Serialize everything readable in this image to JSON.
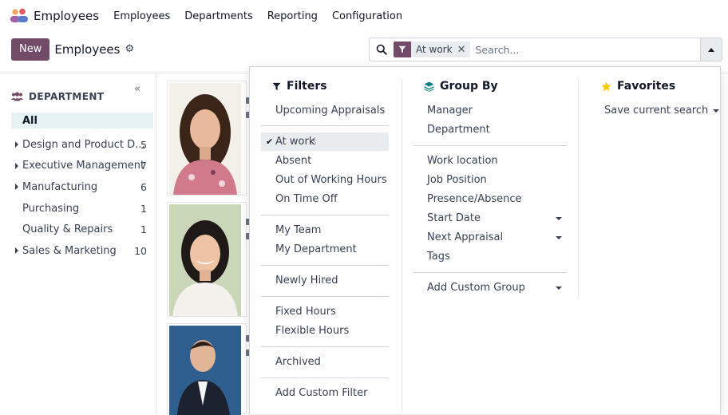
{
  "nav": {
    "app_name": "Employees",
    "menus": [
      "Employees",
      "Departments",
      "Reporting",
      "Configuration"
    ]
  },
  "control_panel": {
    "new_button": "New",
    "breadcrumb": "Employees"
  },
  "search": {
    "facet_value": "At work",
    "placeholder": "Search..."
  },
  "sidebar": {
    "header": "DEPARTMENT",
    "items": [
      {
        "label": "All",
        "count": "",
        "active": true,
        "expandable": false
      },
      {
        "label": "Design and Product D...",
        "count": "5",
        "expandable": true
      },
      {
        "label": "Executive Management",
        "count": "7",
        "expandable": true
      },
      {
        "label": "Manufacturing",
        "count": "6",
        "expandable": true
      },
      {
        "label": "Purchasing",
        "count": "1",
        "expandable": false
      },
      {
        "label": "Quality & Repairs",
        "count": "1",
        "expandable": false
      },
      {
        "label": "Sales & Marketing",
        "count": "10",
        "expandable": true
      }
    ]
  },
  "filters": {
    "title": "Filters",
    "items": [
      "Upcoming Appraisals",
      "At work",
      "Absent",
      "Out of Working Hours",
      "On Time Off",
      "My Team",
      "My Department",
      "Newly Hired",
      "Fixed Hours",
      "Flexible Hours",
      "Archived",
      "Add Custom Filter"
    ],
    "selected": "At work"
  },
  "group_by": {
    "title": "Group By",
    "items": [
      "Manager",
      "Department",
      "Work location",
      "Job Position",
      "Presence/Absence",
      "Start Date",
      "Next Appraisal",
      "Tags",
      "Add Custom Group"
    ]
  },
  "favorites": {
    "title": "Favorites",
    "save_label": "Save current search"
  },
  "colors": {
    "brand": "#714b67",
    "active_bg": "#e6f2f3",
    "star": "#f3cc00",
    "group_icon": "#017e84"
  }
}
